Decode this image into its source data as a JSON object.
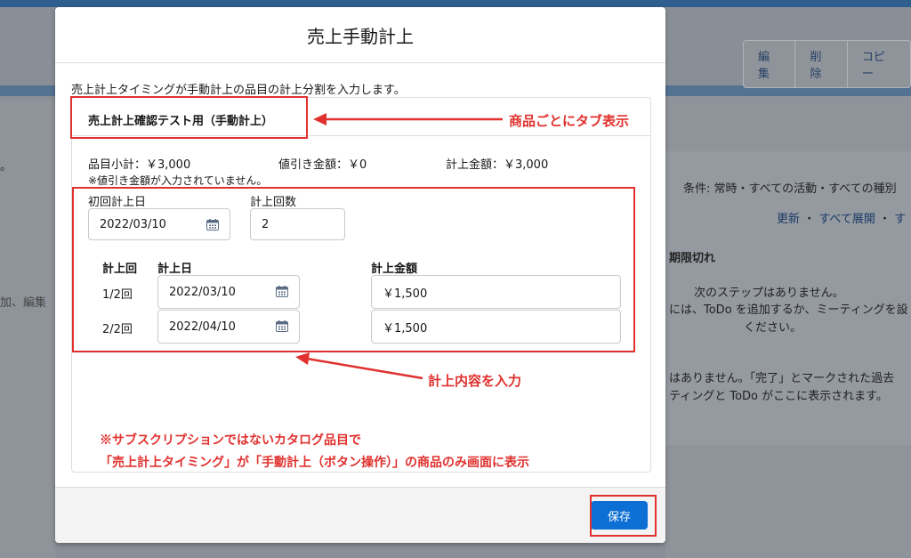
{
  "background": {
    "buttons": [
      "編集",
      "削除",
      "コピー"
    ],
    "left_fragments": [
      "。",
      "加、編集"
    ],
    "right_condition": "条件: 常時・すべての活動・すべての種別",
    "right_links": [
      "更新",
      "すべて展開",
      "す"
    ],
    "right_dot": "・",
    "right_overdue": "期限切れ",
    "right_nextstep": "次のステップはありません。",
    "right_todo_line1": "には、ToDo を追加するか、ミーティングを設",
    "right_todo_line2": "ください。",
    "right_past_line1": "はありません。「完了」とマークされた過去",
    "right_past_line2": "ティングと ToDo がここに表示されます。"
  },
  "modal": {
    "title": "売上手動計上",
    "intro": "売上計上タイミングが手動計上の品目の計上分割を入力します。",
    "tab_label": "売上計上確認テスト用（手動計上）",
    "summary": {
      "subtotal": "品目小計：￥3,000",
      "discount": "値引き金額：￥0",
      "amount": "計上金額：￥3,000"
    },
    "note": "※値引き金額が入力されていません。",
    "first_date_label": "初回計上日",
    "first_date_value": "2022/03/10",
    "count_label": "計上回数",
    "count_value": "2",
    "table_headers": {
      "round": "計上回",
      "date": "計上日",
      "amount": "計上金額"
    },
    "rows": [
      {
        "round": "1/2回",
        "date": "2022/03/10",
        "amount": "￥1,500"
      },
      {
        "round": "2/2回",
        "date": "2022/04/10",
        "amount": "￥1,500"
      }
    ],
    "save_label": "保存"
  },
  "annotations": {
    "tab": "商品ごとにタブ表示",
    "input": "計上内容を入力",
    "note_line1": "※サブスクリプションではないカタログ品目で",
    "note_line2": "「売上計上タイミング」が「手動計上（ボタン操作）」の商品のみ画面に表示"
  },
  "colors": {
    "accent": "#0b6fd4",
    "annotation": "#e0312e"
  }
}
